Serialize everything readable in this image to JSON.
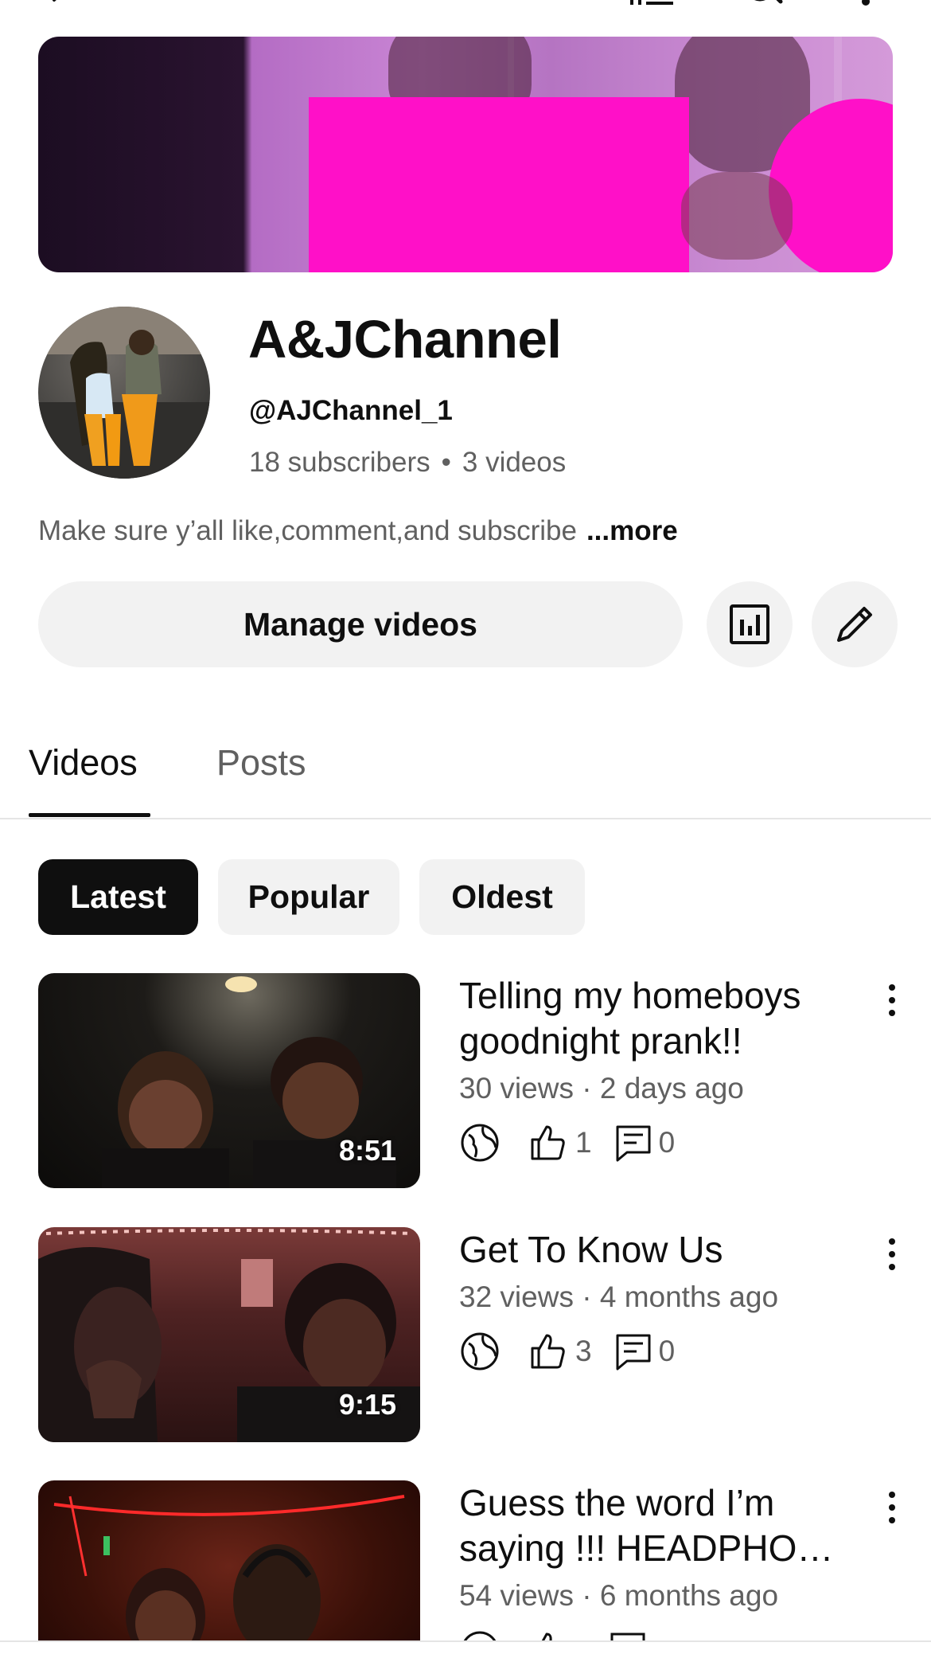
{
  "channel": {
    "name": "A&JChannel",
    "handle": "@AJChannel_1",
    "subscribers": "18 subscribers",
    "separator": "•",
    "video_count": "3 videos",
    "description": "Make sure y’all like,comment,and subscribe",
    "more_label": "...more"
  },
  "actions": {
    "manage_label": "Manage videos"
  },
  "tabs": [
    {
      "label": "Videos",
      "active": true
    },
    {
      "label": "Posts",
      "active": false
    }
  ],
  "filters": [
    {
      "label": "Latest",
      "active": true
    },
    {
      "label": "Popular",
      "active": false
    },
    {
      "label": "Oldest",
      "active": false
    }
  ],
  "videos": [
    {
      "title": "Telling my homeboys goodnight prank!!",
      "duration": "8:51",
      "meta": "30 views · 2 days ago",
      "likes": "1",
      "comments": "0"
    },
    {
      "title": "Get To Know Us",
      "duration": "9:15",
      "meta": "32 views · 4 months ago",
      "likes": "3",
      "comments": "0"
    },
    {
      "title": "Guess the word I’m saying !!!  HEADPHO…",
      "meta": "54 views · 6 months ago"
    }
  ],
  "colors": {
    "accent_pink": "#ff10c8",
    "chip_active": "#0f0f0f",
    "secondary_text": "#606060"
  },
  "icons": [
    "back-arrow-icon",
    "library-icon",
    "search-icon",
    "more-vert-icon",
    "analytics-icon",
    "pencil-icon",
    "globe-icon",
    "thumbs-up-icon",
    "comment-icon",
    "kebab-icon"
  ]
}
